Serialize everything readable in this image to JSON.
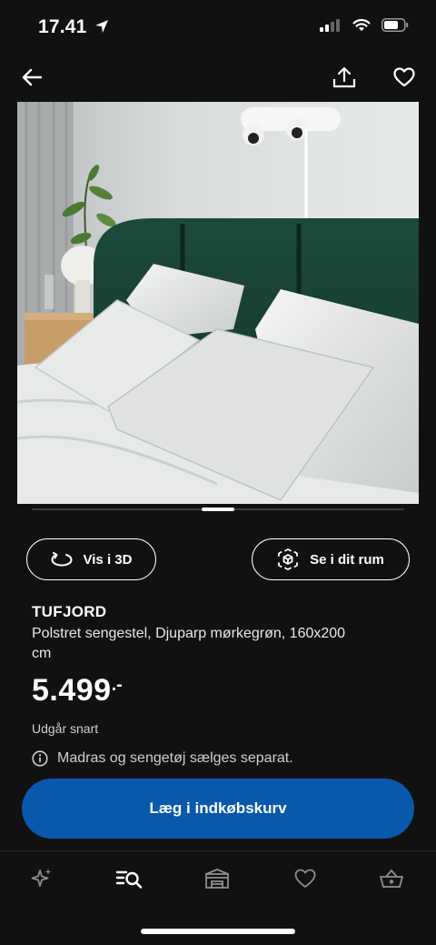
{
  "status_bar": {
    "time": "17.41"
  },
  "nav": {
    "back": "arrow-left-icon",
    "share": "share-icon",
    "favorite": "heart-icon"
  },
  "gallery": {
    "current_index": 4,
    "total": 7
  },
  "actions": {
    "view_3d_label": "Vis i 3D",
    "view_room_label": "Se i dit rum"
  },
  "product": {
    "name": "TUFJORD",
    "description": "Polstret sengestel, Djuparp mørkegrøn, 160x200 cm",
    "price": "5.499",
    "price_suffix": ".-",
    "availability": "Udgår snart",
    "notice": "Madras og sengetøj sælges separat."
  },
  "cta": {
    "label": "Læg i indkøbskurv",
    "color": "#0a58ab"
  },
  "tabbar": {
    "items": [
      {
        "icon": "sparkle-icon",
        "active": false
      },
      {
        "icon": "search-list-icon",
        "active": true
      },
      {
        "icon": "store-icon",
        "active": false
      },
      {
        "icon": "heart-icon",
        "active": false
      },
      {
        "icon": "basket-icon",
        "active": false
      }
    ]
  }
}
